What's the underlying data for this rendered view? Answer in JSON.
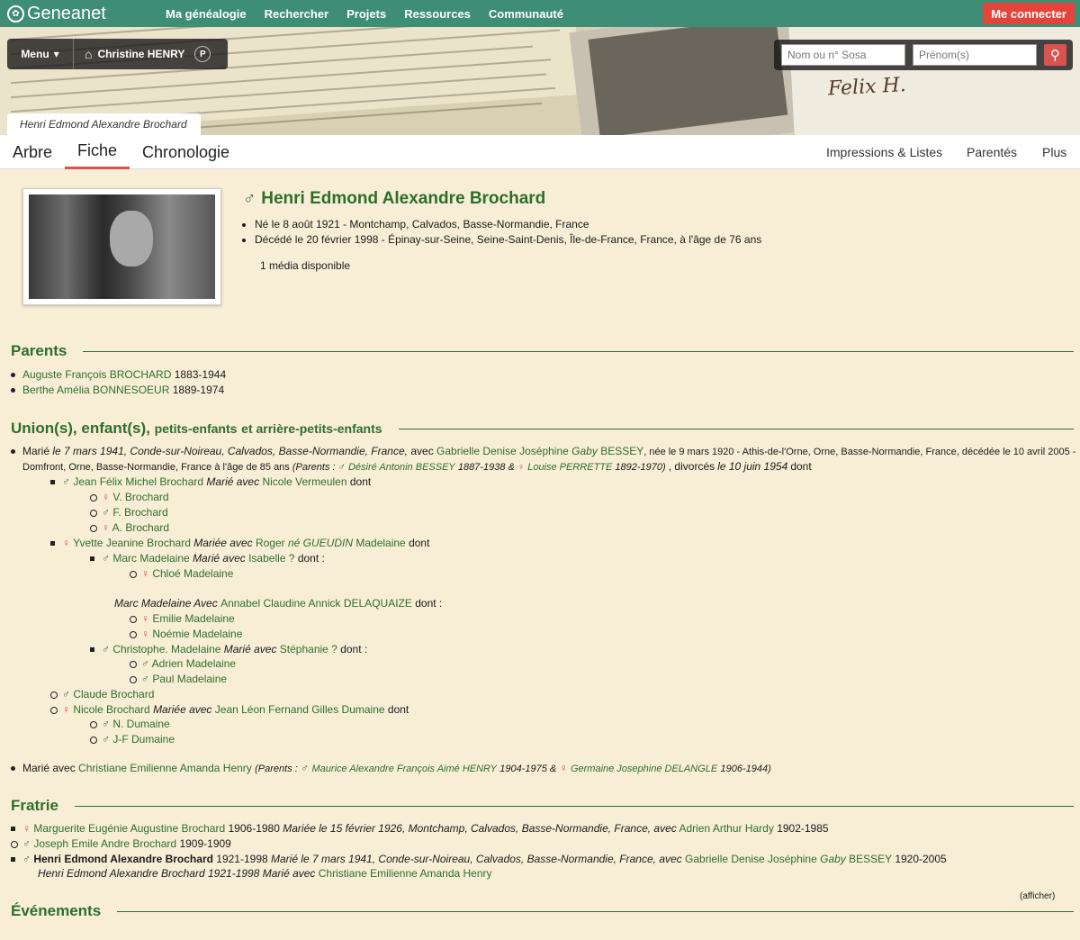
{
  "site": {
    "logo": "Geneanet"
  },
  "nav": [
    "Ma généalogie",
    "Rechercher",
    "Projets",
    "Ressources",
    "Communauté"
  ],
  "connect": "Me connecter",
  "menu": {
    "label": "Menu",
    "owner": "Christine HENRY",
    "badge": "P"
  },
  "search": {
    "name_placeholder": "Nom ou n° Sosa",
    "first_placeholder": "Prénom(s)"
  },
  "breadcrumb": "Henri Edmond Alexandre Brochard",
  "tabs": [
    "Arbre",
    "Fiche",
    "Chronologie"
  ],
  "right_tabs": [
    "Impressions & Listes",
    "Parentés",
    "Plus"
  ],
  "person": {
    "name": "Henri Edmond Alexandre Brochard",
    "born": "Né le 8 août 1921 - Montchamp, Calvados, Basse-Normandie, France",
    "died": "Décédé le 20 février 1998 - Épinay-sur-Seine, Seine-Saint-Denis, Île-de-France, France, à l'âge de 76 ans",
    "media": "1 média disponible"
  },
  "sections": {
    "parents": "Parents",
    "unions": "Union(s), enfant(s),",
    "unions_small": "petits-enfants",
    "unions_and": "et arrière-petits-enfants",
    "fratrie": "Fratrie",
    "events": "Événements"
  },
  "parents": [
    {
      "name": "Auguste François BROCHARD",
      "years": "1883-1944"
    },
    {
      "name": "Berthe Amélia BONNESOEUR",
      "years": "1889-1974"
    }
  ],
  "union1": {
    "a": "Marié",
    "b": "le 7 mars 1941, Conde-sur-Noireau, Calvados, Basse-Normandie, France,",
    "c": "avec",
    "spouse": "Gabrielle Denise Joséphine",
    "spouse_nick": "Gaby",
    "spouse_last": "BESSEY",
    "spouse_born": ", née le 9 mars 1920 - Athis-de-l'Orne, Orne, Basse-Normandie, France, décédée le 10 avril 2005 -",
    "line2a": "Domfront, Orne, Basse-Normandie, France à l'âge de 85 ans",
    "line2b": "(Parents :",
    "father": "Désiré Antonin BESSEY",
    "father_years": "1887-1938 &",
    "mother": "Louise PERRETTE",
    "mother_years": "1892-1970)",
    "divorce_a": ", divorcés",
    "divorce_b": "le 10 juin 1954",
    "divorce_c": "dont"
  },
  "tree": [
    {
      "name": "Jean Félix Michel Brochard",
      "rest_a": "Marié avec",
      "spouse": "Nicole Vermeulen",
      "rest_b": "dont"
    },
    {
      "name": "V. Brochard"
    },
    {
      "name": "F. Brochard"
    },
    {
      "name": "A. Brochard"
    },
    {
      "name": "Yvette Jeanine Brochard",
      "rest_a": "Mariée avec",
      "spouse": "Roger",
      "spouse_it": "né GUEUDIN",
      "spouse_b": "Madelaine",
      "rest_b": "dont"
    },
    {
      "name": "Marc Madelaine",
      "rest_a": "Marié avec",
      "spouse": "Isabelle ?",
      "rest_b": "dont :"
    },
    {
      "name": "Chloé Madelaine"
    },
    {
      "pre": "Marc Madelaine  Avec",
      "spouse": "Annabel Claudine Annick DELAQUAIZE",
      "rest_b": "dont :"
    },
    {
      "name": "Emilie Madelaine"
    },
    {
      "name": "Noémie Madelaine"
    },
    {
      "name": "Christophe. Madelaine",
      "rest_a": "Marié avec",
      "spouse": "Stéphanie ?",
      "rest_b": "dont :"
    },
    {
      "name": "Adrien Madelaine"
    },
    {
      "name": "Paul Madelaine"
    },
    {
      "name": "Claude Brochard"
    },
    {
      "name": "Nicole Brochard",
      "rest_a": "Mariée avec",
      "spouse": "Jean Léon Fernand Gilles Dumaine",
      "rest_b": "dont"
    },
    {
      "name": "N. Dumaine"
    },
    {
      "name": "J-F Dumaine"
    }
  ],
  "union2": {
    "a": "Marié avec",
    "spouse": "Christiane Emilienne Amanda Henry",
    "b": "(Parents :",
    "father": "Maurice Alexandre François Aimé HENRY",
    "father_years": "1904-1975 &",
    "mother": "Germaine Josephine DELANGLE",
    "mother_years": "1906-1944)"
  },
  "fratrie": [
    {
      "name": "Marguerite Eugénie Augustine Brochard",
      "years": "1906-1980",
      "it": "Mariée le 15 février 1926, Montchamp, Calvados, Basse-Normandie, France, avec",
      "spouse": "Adrien Arthur Hardy",
      "spouse_years": "1902-1985"
    },
    {
      "name": "Joseph Emile Andre Brochard",
      "years": "1909-1909"
    },
    {
      "name": "Henri Edmond Alexandre Brochard",
      "years": "1921-1998",
      "it": "Marié le 7 mars 1941, Conde-sur-Noireau, Calvados, Basse-Normandie, France, avec",
      "spouse": "Gabrielle Denise Joséphine",
      "spouse_nick": "Gaby",
      "spouse_last": "BESSEY",
      "spouse_years": "1920-2005"
    },
    {
      "it2": "Henri Edmond Alexandre Brochard",
      "years": "1921-1998",
      "it": "Marié avec",
      "spouse": "Christiane Emilienne Amanda Henry"
    }
  ],
  "afficher": "(afficher)",
  "colors": {
    "green": "#3e8d77",
    "link": "#2d6e2d",
    "female": "#d94a5a",
    "red": "#e3453a"
  }
}
